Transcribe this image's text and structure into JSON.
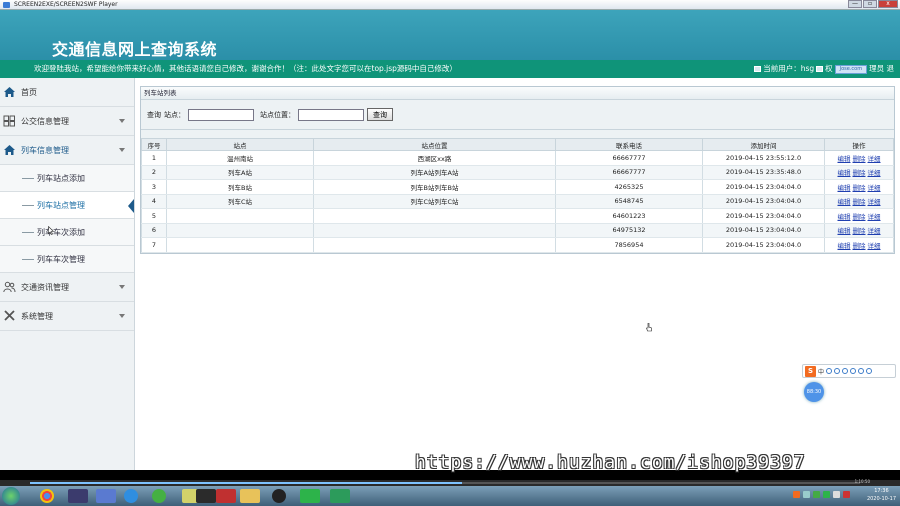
{
  "player": {
    "title": "SCREEN2EXE/SCREEN2SWF Player",
    "buttons": [
      "—",
      "▫",
      "x"
    ]
  },
  "header": {
    "title": "交通信息网上查询系统",
    "marquee": "欢迎登陆我站，希望能给你带来好心情，其他话语请您自己修改，谢谢合作！（注：此处文字您可以在top.jsp源码中自己修改）",
    "user_label": "当前用户：hsg",
    "user_extra_1": "权",
    "user_badge": "Jose.com",
    "user_extra_2": "理员 退"
  },
  "sidebar": {
    "items": [
      {
        "label": "首页",
        "icon": "home-icon"
      },
      {
        "label": "公交信息管理",
        "icon": "grid-icon"
      },
      {
        "label": "列车信息管理",
        "icon": "home-icon"
      },
      {
        "label": "交通资讯管理",
        "icon": "users-icon"
      },
      {
        "label": "系统管理",
        "icon": "wrench-icon"
      }
    ],
    "subitems": [
      {
        "label": "列车站点添加"
      },
      {
        "label": "列车站点管理"
      },
      {
        "label": "列车车次添加"
      },
      {
        "label": "列车车次管理"
      }
    ]
  },
  "panel": {
    "title": "列车站列表",
    "search_label": "查询",
    "field1_label": "站点：",
    "field2_label": "站点位置：",
    "search_button": "查询",
    "columns": [
      "序号",
      "站点",
      "站点位置",
      "联系电话",
      "添加时间",
      "操作"
    ],
    "rows": [
      {
        "no": "1",
        "station": "温州南站",
        "location": "西湖区xx路",
        "phone": "66667777",
        "time": "2019-04-15 23:55:12.0"
      },
      {
        "no": "2",
        "station": "列车A站",
        "location": "列车A站列车A站",
        "phone": "66667777",
        "time": "2019-04-15 23:35:48.0"
      },
      {
        "no": "3",
        "station": "列车B站",
        "location": "列车B站列车B站",
        "phone": "4265325",
        "time": "2019-04-15 23:04:04.0"
      },
      {
        "no": "4",
        "station": "列车C站",
        "location": "列车C站列车C站",
        "phone": "6548745",
        "time": "2019-04-15 23:04:04.0"
      },
      {
        "no": "5",
        "station": "",
        "location": "",
        "phone": "64601223",
        "time": "2019-04-15 23:04:04.0"
      },
      {
        "no": "6",
        "station": "",
        "location": "",
        "phone": "64975132",
        "time": "2019-04-15 23:04:04.0"
      },
      {
        "no": "7",
        "station": "",
        "location": "",
        "phone": "7856954",
        "time": "2019-04-15 23:04:04.0"
      }
    ],
    "ops": [
      "编辑",
      "删除",
      "详细"
    ]
  },
  "ime": {
    "logo": "S",
    "label": "中"
  },
  "float_ball": "88:30",
  "watermark": "https://www.huzhan.com/ishop39397",
  "playback": {
    "progress": 0.52,
    "time": "1:10:50"
  },
  "taskbar": {
    "time": "17:36",
    "date": "2020-10-17"
  }
}
